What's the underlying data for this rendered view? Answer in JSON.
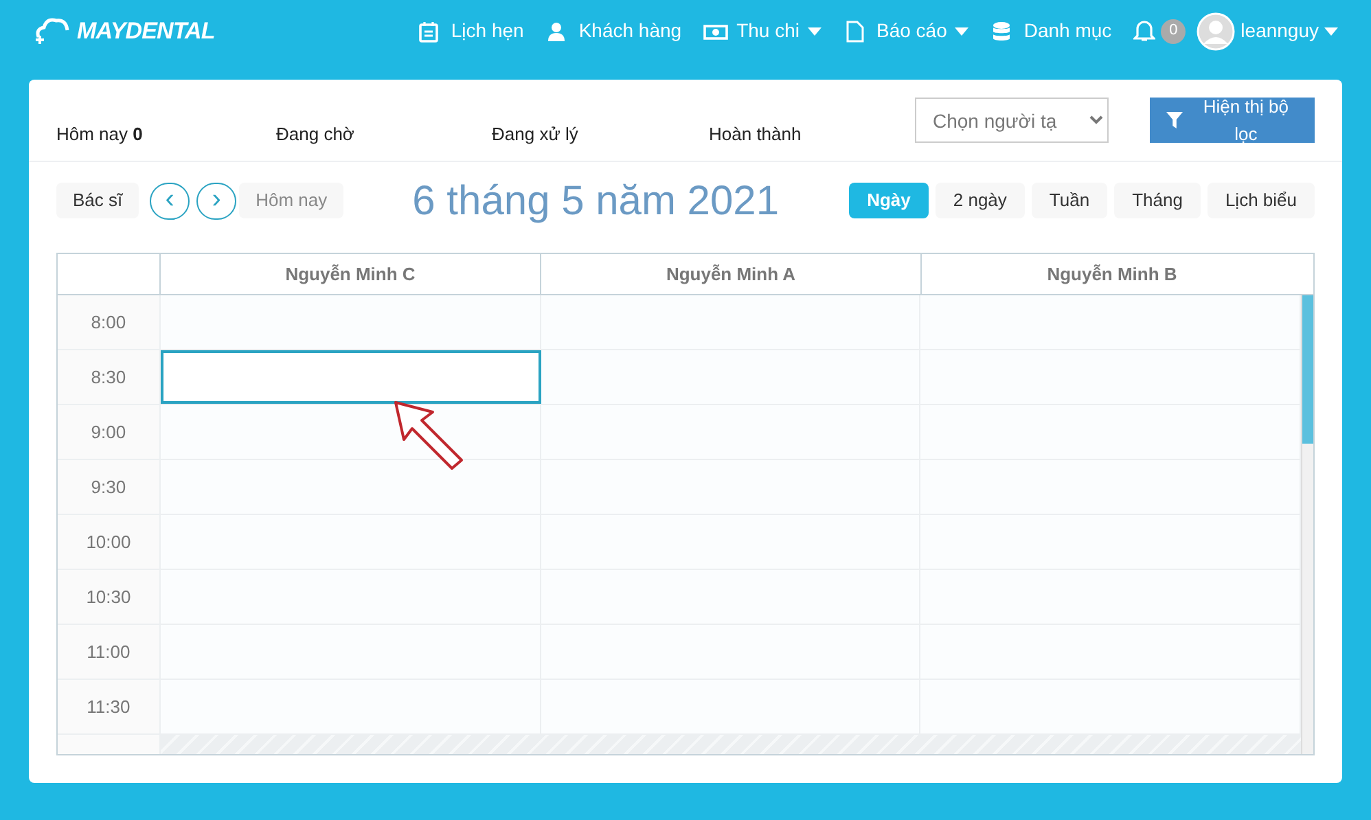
{
  "brand": "MAYDENTAL",
  "nav": [
    {
      "label": "Lịch hẹn",
      "caret": false
    },
    {
      "label": "Khách hàng",
      "caret": false
    },
    {
      "label": "Thu chi",
      "caret": true
    },
    {
      "label": "Báo cáo",
      "caret": true
    },
    {
      "label": "Danh mục",
      "caret": false
    }
  ],
  "notifications": {
    "count": "0"
  },
  "user": {
    "name": "leannguy"
  },
  "status_tabs": [
    {
      "label": "Hôm nay",
      "count": "0"
    },
    {
      "label": "Đang chờ"
    },
    {
      "label": "Đang xử lý"
    },
    {
      "label": "Hoàn thành"
    }
  ],
  "creator_select": {
    "placeholder": "Chọn người tạ"
  },
  "filter_button": "Hiện thị bộ lọc",
  "doctor_button": "Bác sĩ",
  "prev_button": "‹",
  "next_button": "›",
  "today_button": "Hôm nay",
  "date_title": "6 tháng 5 năm 2021",
  "views": [
    {
      "label": "Ngày",
      "selected": true
    },
    {
      "label": "2 ngày",
      "selected": false
    },
    {
      "label": "Tuần",
      "selected": false
    },
    {
      "label": "Tháng",
      "selected": false
    },
    {
      "label": "Lịch biểu",
      "selected": false
    }
  ],
  "columns": [
    "Nguyễn Minh C",
    "Nguyễn Minh A",
    "Nguyễn Minh B"
  ],
  "rows": [
    {
      "time": "8:00",
      "cells": [
        {
          "selected": false
        },
        {
          "selected": false
        },
        {
          "selected": false
        }
      ]
    },
    {
      "time": "8:30",
      "cells": [
        {
          "selected": true
        },
        {
          "selected": false
        },
        {
          "selected": false
        }
      ]
    },
    {
      "time": "9:00",
      "cells": [
        {
          "selected": false
        },
        {
          "selected": false
        },
        {
          "selected": false
        }
      ]
    },
    {
      "time": "9:30",
      "cells": [
        {
          "selected": false
        },
        {
          "selected": false
        },
        {
          "selected": false
        }
      ]
    },
    {
      "time": "10:00",
      "cells": [
        {
          "selected": false
        },
        {
          "selected": false
        },
        {
          "selected": false
        }
      ]
    },
    {
      "time": "10:30",
      "cells": [
        {
          "selected": false
        },
        {
          "selected": false
        },
        {
          "selected": false
        }
      ]
    },
    {
      "time": "11:00",
      "cells": [
        {
          "selected": false
        },
        {
          "selected": false
        },
        {
          "selected": false
        }
      ]
    },
    {
      "time": "11:30",
      "cells": [
        {
          "selected": false
        },
        {
          "selected": false
        },
        {
          "selected": false
        }
      ]
    }
  ]
}
